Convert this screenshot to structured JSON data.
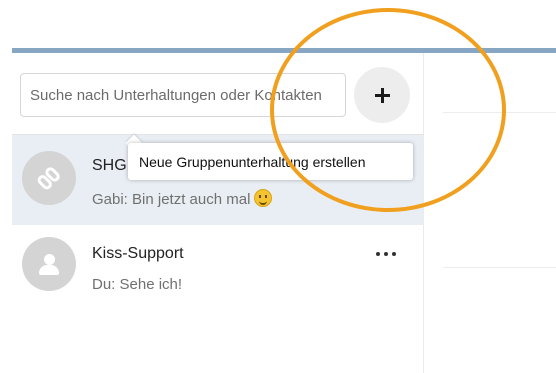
{
  "search": {
    "placeholder": "Suche nach Unterhaltungen oder Kontakten"
  },
  "add_button": {
    "tooltip": "Neue Gruppenunterhaltung erstellen"
  },
  "conversations": [
    {
      "name": "SHG",
      "last_message": "Gabi: Bin jetzt auch mal",
      "avatar_icon": "link-icon",
      "active": true,
      "emoji": "smiling-face-emoji"
    },
    {
      "name": "Kiss-Support",
      "last_message": "Du: Sehe ich!",
      "avatar_icon": "group-icon",
      "active": false
    }
  ],
  "colors": {
    "top_bar": "#87a6c4",
    "active_row": "#e9eef4",
    "highlight": "#f0a01e"
  }
}
